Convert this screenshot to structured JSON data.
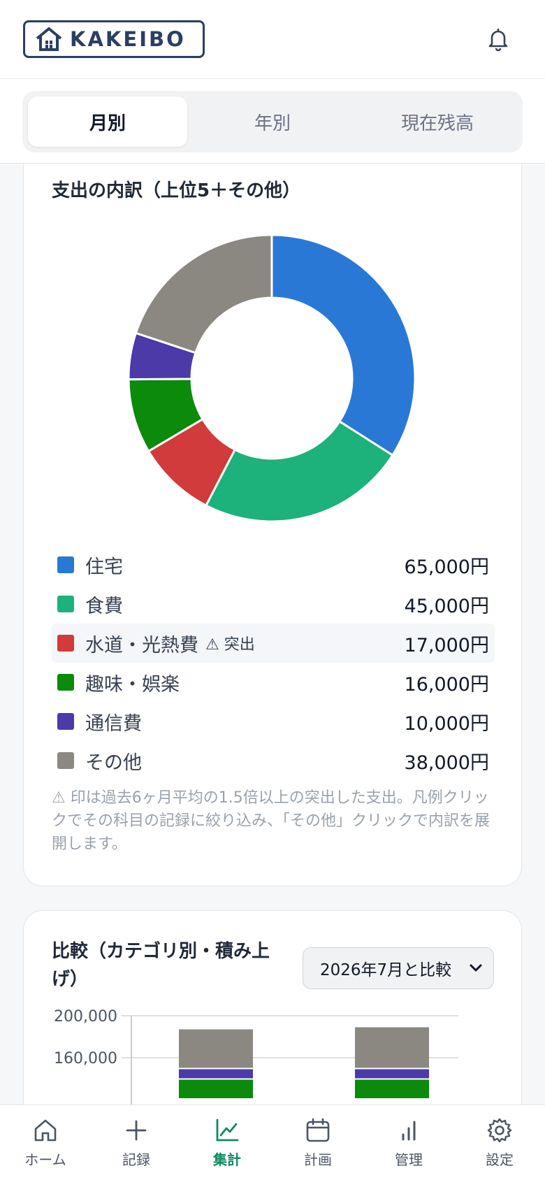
{
  "app": {
    "logo_text": "KAKEIBO"
  },
  "icons": {
    "logo": "house-icon",
    "bell": "bell-icon"
  },
  "tabs": [
    {
      "label": "月別",
      "active": true
    },
    {
      "label": "年別",
      "active": false
    },
    {
      "label": "現在残高",
      "active": false
    }
  ],
  "breakdown": {
    "title": "支出の内訳（上位5＋その他）",
    "note": "⚠ 印は過去6ヶ月平均の1.5倍以上の突出した支出。凡例クリックでその科目の記録に絞り込み、「その他」クリックで内訳を展開します。"
  },
  "chart_data": [
    {
      "type": "pie",
      "style": "donut",
      "categories": [
        "住宅",
        "食費",
        "水道・光熱費",
        "趣味・娯楽",
        "通信費",
        "その他"
      ],
      "values": [
        65000,
        45000,
        17000,
        16000,
        10000,
        38000
      ],
      "value_labels": [
        "65,000円",
        "45,000円",
        "17,000円",
        "16,000円",
        "10,000円",
        "38,000円"
      ],
      "colors": [
        "#2a78d6",
        "#1db17b",
        "#d13b3b",
        "#0b8a0b",
        "#4b3aa8",
        "#8a8880"
      ],
      "flags": [
        "",
        "",
        "⚠ 突出",
        "",
        "",
        ""
      ],
      "legend": "bottom"
    },
    {
      "type": "bar",
      "stacked": true,
      "title": "比較（カテゴリ別・積み上げ）",
      "y_ticks": [
        "200,000",
        "160,000"
      ],
      "ylim": [
        0,
        200000
      ],
      "grid": true,
      "series": [
        {
          "values": [
            19000,
            19000
          ],
          "color": "#0b8a0b"
        },
        {
          "values": [
            10000,
            10000
          ],
          "color": "#4b3aa8"
        },
        {
          "values": [
            38000,
            40000
          ],
          "color": "#8a8880"
        }
      ],
      "visible_top_totals": [
        187000,
        189000
      ]
    }
  ],
  "compare": {
    "select_value": "2026年7月と比較"
  },
  "nav": [
    {
      "label": "ホーム",
      "icon": "home-icon",
      "active": false
    },
    {
      "label": "記録",
      "icon": "plus-icon",
      "active": false
    },
    {
      "label": "集計",
      "icon": "chart-line-icon",
      "active": true
    },
    {
      "label": "計画",
      "icon": "calendar-icon",
      "active": false
    },
    {
      "label": "管理",
      "icon": "bar-chart-icon",
      "active": false
    },
    {
      "label": "設定",
      "icon": "gear-icon",
      "active": false
    }
  ]
}
